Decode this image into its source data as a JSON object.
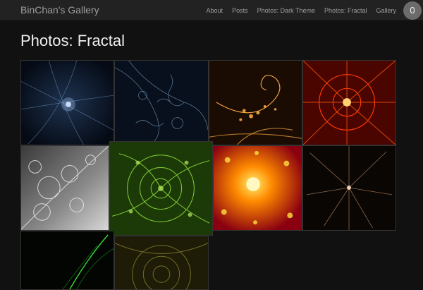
{
  "navbar": {
    "brand": "BinChan's Gallery",
    "links": [
      "About",
      "Posts",
      "Photos: Dark Theme",
      "Photos: Fractal",
      "Gallery"
    ],
    "badge": "0"
  },
  "page": {
    "title": "Photos: Fractal"
  },
  "gallery": {
    "tiles": [
      {
        "name": "fractal-blue-star"
      },
      {
        "name": "fractal-blue-ferns"
      },
      {
        "name": "fractal-orange-spiral"
      },
      {
        "name": "fractal-red-burst"
      },
      {
        "name": "fractal-silver-bubbles"
      },
      {
        "name": "fractal-green-lace"
      },
      {
        "name": "fractal-yellow-starburst"
      },
      {
        "name": "fractal-brown-rays"
      },
      {
        "name": "fractal-green-streak"
      },
      {
        "name": "fractal-olive-rings"
      }
    ]
  }
}
